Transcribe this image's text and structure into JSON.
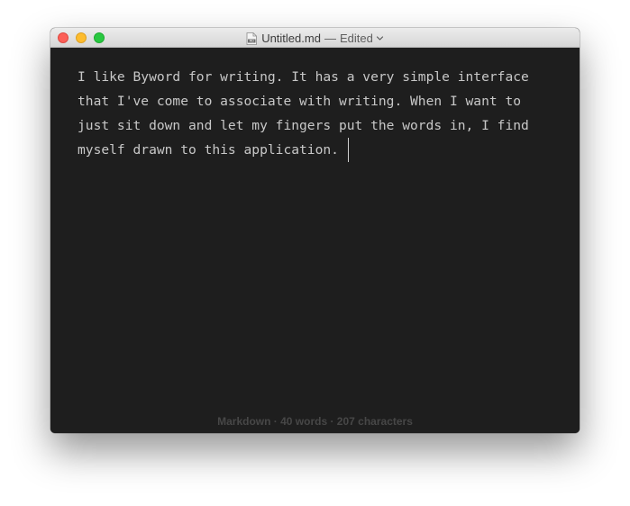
{
  "window": {
    "filename": "Untitled.md",
    "separator": "—",
    "status": "Edited",
    "doc_icon": "markdown-document-icon",
    "traffic_lights": {
      "close_color": "#fc5f57",
      "minimize_color": "#fdbc2e",
      "zoom_color": "#28c840"
    }
  },
  "editor": {
    "lines": [
      "I like Byword for writing. It has a very simple interface",
      "that I've come to associate with writing. When I want to",
      "just sit down and let my fingers put the words in, I find",
      "myself drawn to this application. "
    ],
    "background": "#1e1e1e",
    "text_color": "#c8c8c8"
  },
  "statusbar": {
    "text": "Markdown · 40 words · 207 characters"
  }
}
